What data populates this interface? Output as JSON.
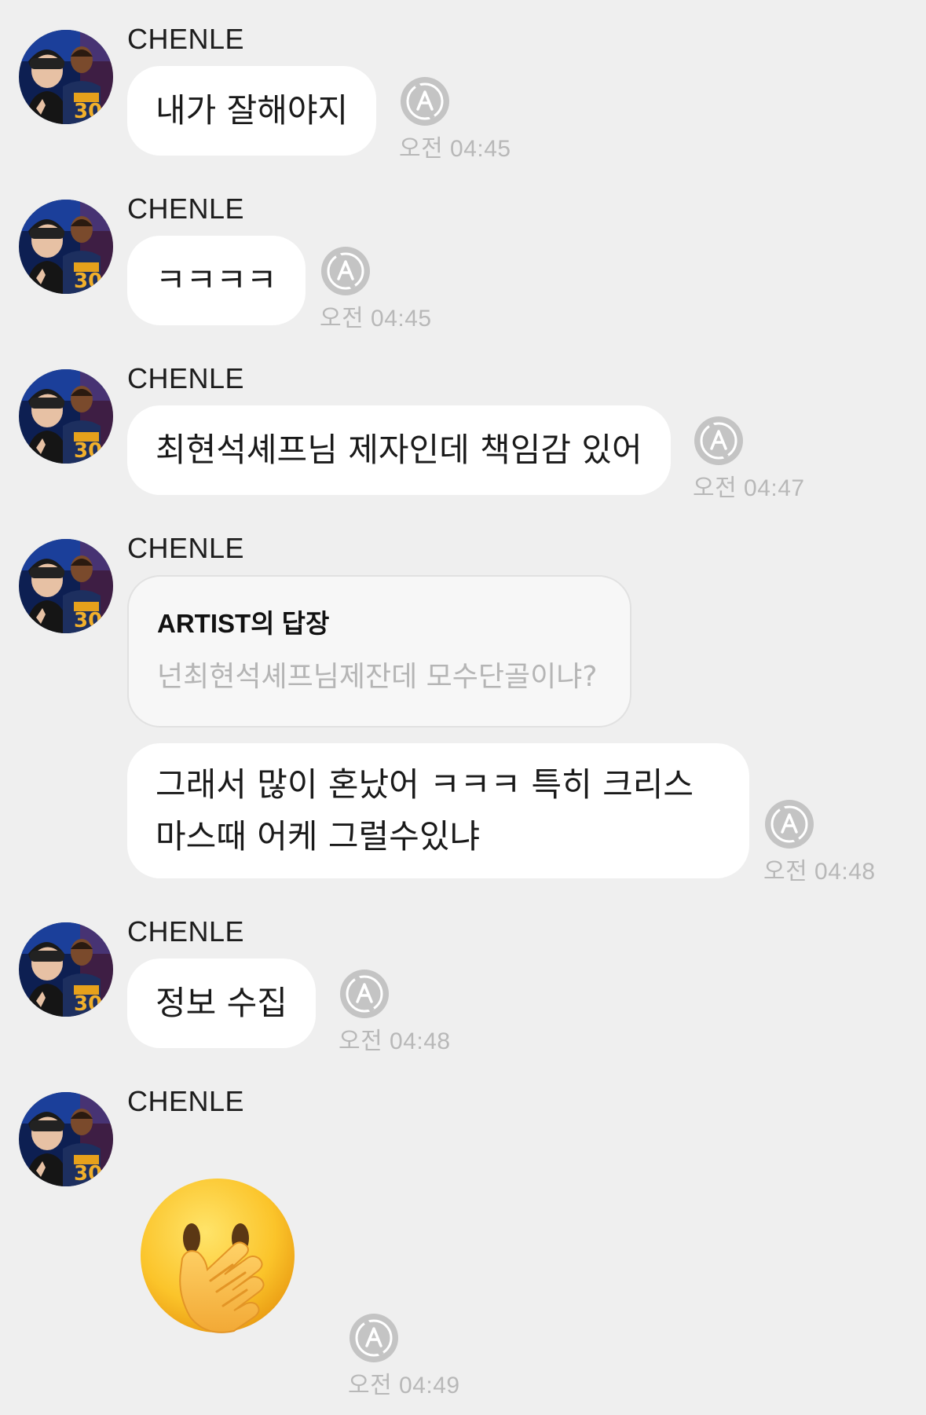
{
  "messages": [
    {
      "sender": "CHENLE",
      "text": "내가 잘해야지",
      "time": "오전 04:45"
    },
    {
      "sender": "CHENLE",
      "text": "ㅋㅋㅋㅋ",
      "time": "오전 04:45"
    },
    {
      "sender": "CHENLE",
      "text": "최현석셰프님 제자인데 책임감 있어",
      "time": "오전 04:47"
    },
    {
      "sender": "CHENLE",
      "reply": {
        "title": "ARTIST의 답장",
        "quote": "넌최현석셰프님제잔데 모수단골이냐?"
      },
      "text": "그래서 많이 혼났어 ㅋㅋㅋ 특히 크리스마스때 어케 그럴수있냐",
      "time": "오전 04:48"
    },
    {
      "sender": "CHENLE",
      "text": "정보 수집",
      "time": "오전 04:48"
    },
    {
      "sender": "CHENLE",
      "emoji": "face-with-hand-over-mouth",
      "time": "오전 04:49"
    }
  ],
  "icons": {
    "status": "translate-a-icon",
    "avatar": "profile-photo"
  },
  "colors": {
    "background": "#efefef",
    "bubble": "#ffffff",
    "reply_card": "#f7f7f7",
    "time_text": "#b8b8b8",
    "status_icon": "#c4c4c4"
  }
}
